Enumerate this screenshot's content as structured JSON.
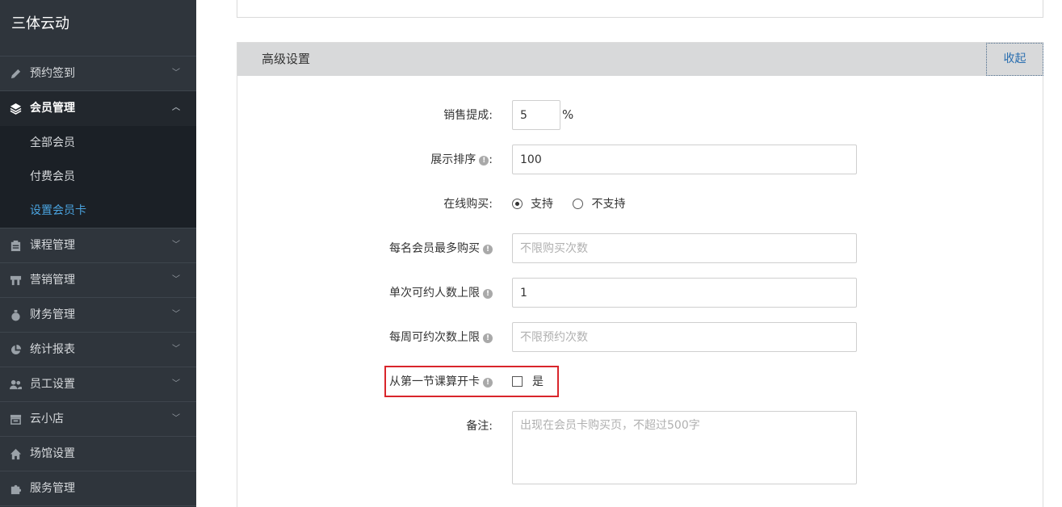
{
  "sidebar": {
    "brand": "三体云动",
    "items": [
      {
        "label": "预约签到",
        "icon": "pencil-icon"
      },
      {
        "label": "会员管理",
        "icon": "layers-icon"
      },
      {
        "label": "课程管理",
        "icon": "clipboard-icon"
      },
      {
        "label": "营销管理",
        "icon": "store-icon"
      },
      {
        "label": "财务管理",
        "icon": "money-bag-icon"
      },
      {
        "label": "统计报表",
        "icon": "pie-chart-icon"
      },
      {
        "label": "员工设置",
        "icon": "users-icon"
      },
      {
        "label": "云小店",
        "icon": "shop-icon"
      },
      {
        "label": "场馆设置",
        "icon": "home-icon"
      },
      {
        "label": "服务管理",
        "icon": "puzzle-icon"
      }
    ],
    "sub_items": [
      "全部会员",
      "付费会员",
      "设置会员卡"
    ]
  },
  "panel": {
    "title": "高级设置",
    "collapse_label": "收起"
  },
  "form": {
    "commission_label": "销售提成:",
    "commission_value": "5",
    "commission_unit": "%",
    "sort_label": "展示排序",
    "sort_suffix": ":",
    "sort_value": "100",
    "online_label": "在线购买:",
    "online_yes": "支持",
    "online_no": "不支持",
    "max_buy_label": "每名会员最多购买",
    "max_buy_placeholder": "不限购买次数",
    "max_people_label": "单次可约人数上限",
    "max_people_value": "1",
    "weekly_label": "每周可约次数上限",
    "weekly_placeholder": "不限预约次数",
    "first_class_label": "从第一节课算开卡",
    "first_class_option": "是",
    "remark_label": "备注:",
    "remark_placeholder": "出现在会员卡购买页，不超过500字"
  },
  "colors": {
    "sidebar_bg": "#2f353c",
    "active_sub": "#4aa3df",
    "highlight": "#d9252b"
  }
}
